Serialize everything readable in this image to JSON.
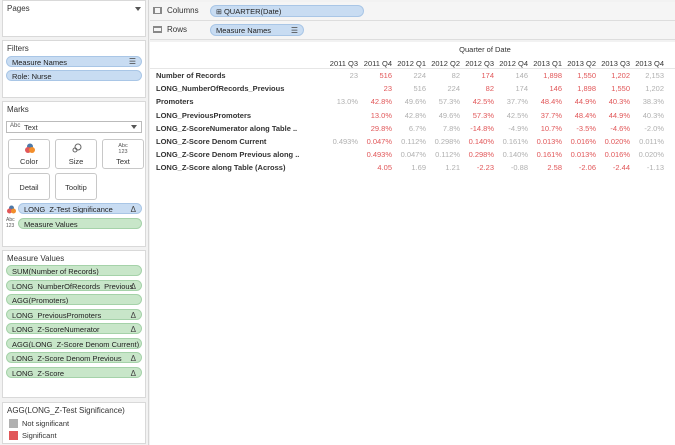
{
  "colors": {
    "significant": "#e15759",
    "not_significant": "#b0b0b0",
    "blue_pill": "#c8dcf2",
    "green_pill": "#c8e6c9"
  },
  "pages": {
    "title": "Pages"
  },
  "filters": {
    "title": "Filters",
    "items": [
      "Measure Names",
      "Role: Nurse"
    ]
  },
  "marks": {
    "title": "Marks",
    "type_prefix": "Abc",
    "type_value": "Text",
    "buttons": {
      "color": "Color",
      "size": "Size",
      "text": "Text",
      "detail": "Detail",
      "tooltip": "Tooltip"
    },
    "text_glyph": "Abc\n123",
    "fields": [
      {
        "label": "LONG_Z-Test Significance",
        "delta": "Δ"
      },
      {
        "label": "Measure Values",
        "delta": ""
      }
    ],
    "abc123": "Abc 123"
  },
  "measure_values": {
    "title": "Measure Values",
    "items": [
      {
        "label": "SUM(Number of Records)",
        "delta": ""
      },
      {
        "label": "LONG_NumberOfRecords_Previous",
        "delta": "Δ"
      },
      {
        "label": "AGG(Promoters)",
        "delta": ""
      },
      {
        "label": "LONG_PreviousPromoters",
        "delta": "Δ"
      },
      {
        "label": "LONG_Z-ScoreNumerator",
        "delta": "Δ"
      },
      {
        "label": "AGG(LONG_Z-Score Denom Current)",
        "delta": ""
      },
      {
        "label": "LONG_Z-Score Denom Previous",
        "delta": "Δ"
      },
      {
        "label": "LONG_Z-Score",
        "delta": "Δ"
      }
    ]
  },
  "legend": {
    "title": "AGG(LONG_Z-Test Significance)",
    "items": [
      "Not significant",
      "Significant"
    ]
  },
  "columns_shelf": {
    "label": "Columns",
    "pill": "QUARTER(Date)",
    "pill_prefix": "⊞"
  },
  "rows_shelf": {
    "label": "Rows",
    "pill": "Measure Names"
  },
  "table": {
    "super_header": "Quarter of Date",
    "columns": [
      "2011 Q3",
      "2011 Q4",
      "2012 Q1",
      "2012 Q2",
      "2012 Q3",
      "2012 Q4",
      "2013 Q1",
      "2013 Q2",
      "2013 Q3",
      "2013 Q4"
    ],
    "rows": [
      {
        "label": "Number of Records",
        "values": [
          "23",
          "516",
          "224",
          "82",
          "174",
          "146",
          "1,898",
          "1,550",
          "1,202",
          "2,153"
        ],
        "sig": [
          0,
          1,
          0,
          0,
          1,
          0,
          1,
          1,
          1,
          0
        ]
      },
      {
        "label": "LONG_NumberOfRecords_Previous",
        "values": [
          "",
          "23",
          "516",
          "224",
          "82",
          "174",
          "146",
          "1,898",
          "1,550",
          "1,202"
        ],
        "sig": [
          0,
          1,
          0,
          0,
          1,
          0,
          1,
          1,
          1,
          0
        ]
      },
      {
        "label": "Promoters",
        "values": [
          "13.0%",
          "42.8%",
          "49.6%",
          "57.3%",
          "42.5%",
          "37.7%",
          "48.4%",
          "44.9%",
          "40.3%",
          "38.3%"
        ],
        "sig": [
          0,
          1,
          0,
          0,
          1,
          0,
          1,
          1,
          1,
          0
        ]
      },
      {
        "label": "LONG_PreviousPromoters",
        "values": [
          "",
          "13.0%",
          "42.8%",
          "49.6%",
          "57.3%",
          "42.5%",
          "37.7%",
          "48.4%",
          "44.9%",
          "40.3%"
        ],
        "sig": [
          0,
          1,
          0,
          0,
          1,
          0,
          1,
          1,
          1,
          0
        ]
      },
      {
        "label": "LONG_Z-ScoreNumerator along Table ..",
        "values": [
          "",
          "29.8%",
          "6.7%",
          "7.8%",
          "-14.8%",
          "-4.9%",
          "10.7%",
          "-3.5%",
          "-4.6%",
          "-2.0%"
        ],
        "sig": [
          0,
          1,
          0,
          0,
          1,
          0,
          1,
          1,
          1,
          0
        ]
      },
      {
        "label": "LONG_Z-Score Denom Current",
        "values": [
          "0.493%",
          "0.047%",
          "0.112%",
          "0.298%",
          "0.140%",
          "0.161%",
          "0.013%",
          "0.016%",
          "0.020%",
          "0.011%"
        ],
        "sig": [
          0,
          1,
          0,
          0,
          1,
          0,
          1,
          1,
          1,
          0
        ]
      },
      {
        "label": "LONG_Z-Score Denom Previous along ..",
        "values": [
          "",
          "0.493%",
          "0.047%",
          "0.112%",
          "0.298%",
          "0.140%",
          "0.161%",
          "0.013%",
          "0.016%",
          "0.020%"
        ],
        "sig": [
          0,
          1,
          0,
          0,
          1,
          0,
          1,
          1,
          1,
          0
        ]
      },
      {
        "label": "LONG_Z-Score along Table (Across)",
        "values": [
          "",
          "4.05",
          "1.69",
          "1.21",
          "-2.23",
          "-0.88",
          "2.58",
          "-2.06",
          "-2.44",
          "-1.13"
        ],
        "sig": [
          0,
          1,
          0,
          0,
          1,
          0,
          1,
          1,
          1,
          0
        ]
      }
    ]
  }
}
